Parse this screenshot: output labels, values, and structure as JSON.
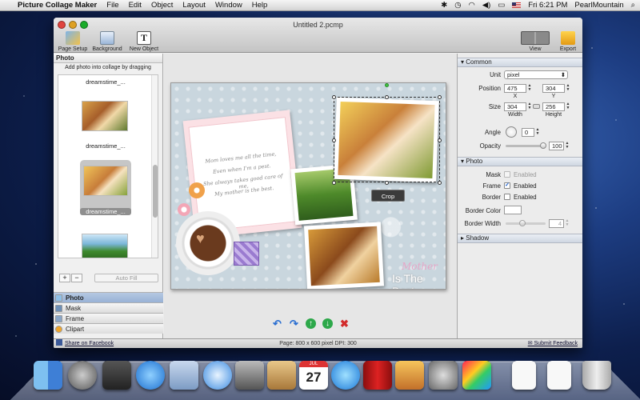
{
  "menubar": {
    "app_name": "Picture Collage Maker",
    "items": [
      "File",
      "Edit",
      "Object",
      "Layout",
      "Window",
      "Help"
    ],
    "clock": "Fri 6:21 PM",
    "user": "PearlMountain"
  },
  "window": {
    "title": "Untitled 2.pcmp",
    "toolbar": {
      "page_setup": "Page Setup",
      "background": "Background",
      "new_object": "New Object",
      "view": "View",
      "export": "Export"
    }
  },
  "left_panel": {
    "header": "Photo",
    "hint": "Add photo into collage by dragging",
    "thumbnails": [
      "dreamstime_...",
      "dreamstime_...",
      "dreamstime_..."
    ],
    "add_symbol": "+",
    "remove_symbol": "−",
    "auto_fill": "Auto Fill",
    "categories": [
      "Photo",
      "Mask",
      "Frame",
      "Clipart"
    ]
  },
  "canvas": {
    "note_lines": [
      "Mom loves me all the time,",
      "Even when I'm a pest.",
      "She always takes good care of me,",
      "My mother is the best."
    ],
    "text_mother": "Mother",
    "text_best": "Is The Best",
    "crop_button": "Crop"
  },
  "properties": {
    "common": {
      "header": "Common",
      "unit_label": "Unit",
      "unit_value": "pixel",
      "position_label": "Position",
      "x_value": "475",
      "y_value": "304",
      "x_sub": "X",
      "y_sub": "Y",
      "size_label": "Size",
      "width_value": "304",
      "height_value": "256",
      "width_sub": "Width",
      "height_sub": "Height",
      "angle_label": "Angle",
      "angle_value": "0",
      "opacity_label": "Opacity",
      "opacity_value": "100"
    },
    "photo": {
      "header": "Photo",
      "mask_label": "Mask",
      "mask_state": "Enabled",
      "mask_checked": false,
      "frame_label": "Frame",
      "frame_state": "Enabled",
      "frame_checked": true,
      "border_label": "Border",
      "border_state": "Enabled",
      "border_checked": false,
      "border_color_label": "Border Color",
      "border_width_label": "Border Width",
      "border_width_value": "4"
    },
    "shadow": {
      "header": "Shadow"
    }
  },
  "status": {
    "share": "Share on Facebook",
    "page_info": "Page: 800 x 600 pixel DPI: 300",
    "feedback": "Submit Feedback"
  },
  "dock": {
    "calendar_day": "27",
    "calendar_month": "JUL",
    "icons": [
      "finder-icon",
      "launchpad-icon",
      "dashboard-icon",
      "app-store-icon",
      "mail-stamp-icon",
      "safari-icon",
      "facetime-icon",
      "address-book-icon",
      "calendar-icon",
      "itunes-icon",
      "photo-booth-icon",
      "iphoto-icon",
      "system-preferences-icon",
      "picture-collage-maker-icon",
      "document-icon",
      "document-icon",
      "trash-icon"
    ]
  },
  "colors": {
    "accent_selection": "#98b2d6",
    "redo_arrow": "#2b6fd1",
    "up_arrow": "#2da84a",
    "delete_red": "#d22a2a"
  }
}
